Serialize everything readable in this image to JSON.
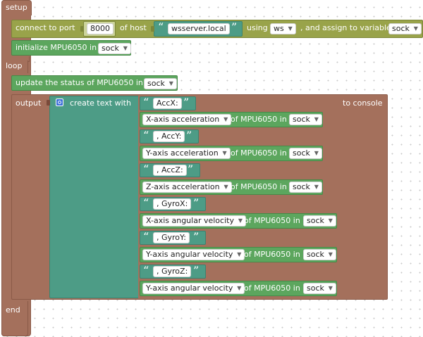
{
  "setup": {
    "label": "setup",
    "connect": {
      "prefix": "connect to port",
      "port": "8000",
      "of_host": "of host",
      "host": "wsserver.local",
      "using": "using",
      "protocol": "ws",
      "assign": ", and assign to variable",
      "variable": "sock"
    },
    "init": {
      "label": "initialize MPU6050 in",
      "variable": "sock"
    }
  },
  "loop": {
    "label": "loop",
    "update": {
      "label": "update the status of MPU6050 in",
      "variable": "sock"
    },
    "output": {
      "label": "output",
      "create_text": "create text with",
      "to_console": "to console",
      "items": [
        {
          "kind": "text",
          "text": "AccX:"
        },
        {
          "kind": "sensor",
          "measure": "X-axis acceleration",
          "of": "of MPU6050 in",
          "variable": "sock"
        },
        {
          "kind": "text",
          "text": ", AccY:"
        },
        {
          "kind": "sensor",
          "measure": "Y-axis acceleration",
          "of": "of MPU6050 in",
          "variable": "sock"
        },
        {
          "kind": "text",
          "text": ", AccZ:"
        },
        {
          "kind": "sensor",
          "measure": "Z-axis acceleration",
          "of": "of MPU6050 in",
          "variable": "sock"
        },
        {
          "kind": "text",
          "text": ", GyroX:"
        },
        {
          "kind": "sensor",
          "measure": "X-axis angular velocity",
          "of": "of MPU6050 in",
          "variable": "sock"
        },
        {
          "kind": "text",
          "text": ", GyroY:"
        },
        {
          "kind": "sensor",
          "measure": "Y-axis angular velocity",
          "of": "of MPU6050 in",
          "variable": "sock"
        },
        {
          "kind": "text",
          "text": ", GyroZ:"
        },
        {
          "kind": "sensor",
          "measure": "Y-axis angular velocity",
          "of": "of MPU6050 in",
          "variable": "sock"
        }
      ]
    }
  },
  "end": {
    "label": "end"
  },
  "colors": {
    "event_block": "#a4705c",
    "network_block": "#99a34a",
    "sensor_block": "#5ca65e",
    "text_block": "#4d9c86",
    "mutator_icon": "#3c6fd8"
  },
  "quote_open": "“",
  "quote_close": "”"
}
